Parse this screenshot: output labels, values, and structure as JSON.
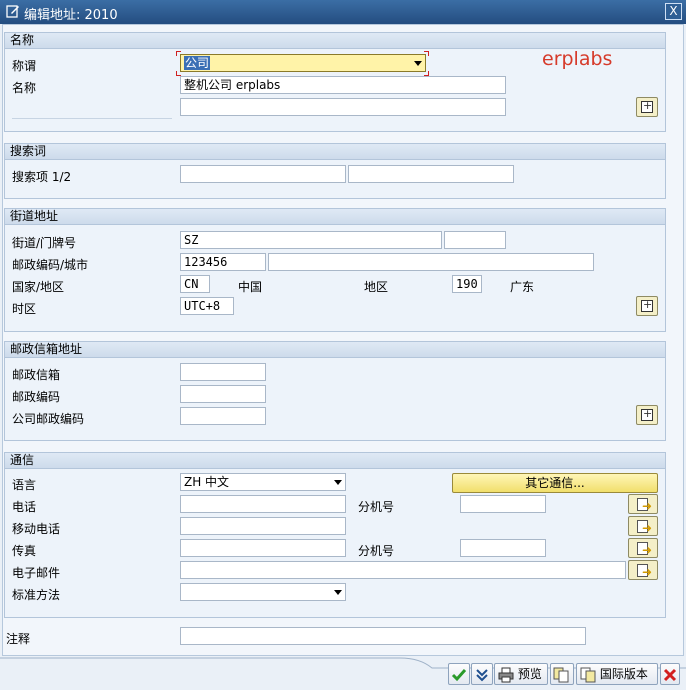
{
  "window": {
    "title": "编辑地址: 2010",
    "close_label": "X"
  },
  "watermark": "erplabs",
  "sections": {
    "name": {
      "title": "名称",
      "title_label": "称谓",
      "title_value": "公司",
      "name_label": "名称",
      "name1": "整机公司 erplabs",
      "name2": ""
    },
    "search": {
      "title": "搜索词",
      "label": "搜索项 1/2",
      "term1": "",
      "term2": ""
    },
    "street": {
      "title": "街道地址",
      "street_label": "街道/门牌号",
      "street": "SZ",
      "house_no": "",
      "postal_city_label": "邮政编码/城市",
      "postal_code": "123456",
      "city": "",
      "country_label": "国家/地区",
      "country_code": "CN",
      "country_name": "中国",
      "region_label": "地区",
      "region_code": "190",
      "region_name": "广东",
      "timezone_label": "时区",
      "timezone": "UTC+8"
    },
    "pobox": {
      "title": "邮政信箱地址",
      "pobox_label": "邮政信箱",
      "pobox": "",
      "postal_label": "邮政编码",
      "postal": "",
      "company_postal_label": "公司邮政编码",
      "company_postal": ""
    },
    "comm": {
      "title": "通信",
      "language_label": "语言",
      "language": "ZH 中文",
      "other_comm_button": "其它通信...",
      "phone_label": "电话",
      "phone": "",
      "ext_label": "分机号",
      "phone_ext": "",
      "mobile_label": "移动电话",
      "mobile": "",
      "fax_label": "传真",
      "fax": "",
      "fax_ext_label": "分机号",
      "fax_ext": "",
      "email_label": "电子邮件",
      "email": "",
      "std_method_label": "标准方法",
      "std_method": ""
    },
    "notes": {
      "label": "注释",
      "value": ""
    }
  },
  "toolbar": {
    "preview": "预览",
    "intl_version": "国际版本"
  },
  "colors": {
    "titlebar": "#244d80",
    "accent_yellow": "#f1df6c",
    "watermark": "#d63a2a"
  }
}
